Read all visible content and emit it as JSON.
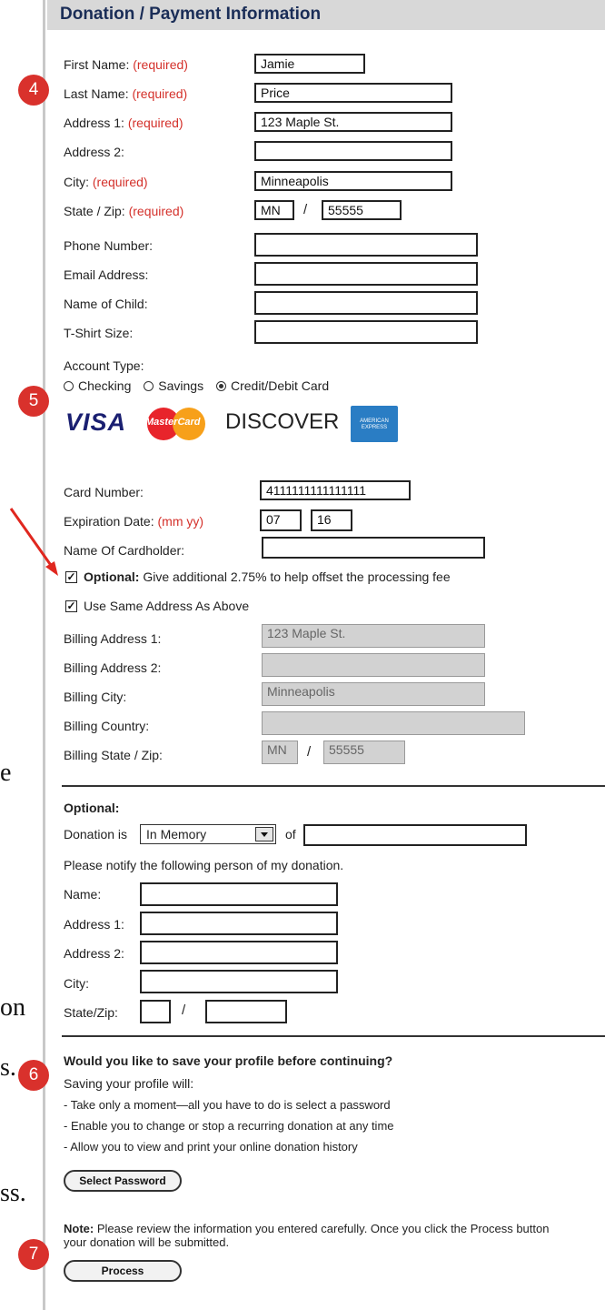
{
  "header": {
    "title": "Donation / Payment Information"
  },
  "badges": {
    "b4": "4",
    "b5": "5",
    "b6": "6",
    "b7": "7"
  },
  "edge_text": {
    "e1": "e",
    "e2": "on",
    "e3": "s.",
    "e4": "ss."
  },
  "personal": {
    "first_name": {
      "label": "First Name:",
      "req": "(required)",
      "value": "Jamie"
    },
    "last_name": {
      "label": "Last Name:",
      "req": "(required)",
      "value": "Price"
    },
    "address1": {
      "label": "Address 1:",
      "req": "(required)",
      "value": "123 Maple St."
    },
    "address2": {
      "label": "Address 2:",
      "value": ""
    },
    "city": {
      "label": "City:",
      "req": "(required)",
      "value": "Minneapolis"
    },
    "state_zip": {
      "label": "State / Zip:",
      "req": "(required)",
      "state": "MN",
      "zip": "55555",
      "sep": "/"
    },
    "phone": {
      "label": "Phone Number:",
      "value": ""
    },
    "email": {
      "label": "Email Address:",
      "value": ""
    },
    "child": {
      "label": "Name of Child:",
      "value": ""
    },
    "tshirt": {
      "label": "T-Shirt Size:",
      "value": ""
    }
  },
  "account": {
    "label": "Account Type:",
    "options": [
      "Checking",
      "Savings",
      "Credit/Debit Card"
    ],
    "selected": "Credit/Debit Card"
  },
  "cards": {
    "visa": "VISA",
    "mastercard": "MasterCard",
    "discover": "DISCOVER",
    "amex": "AMERICAN EXPRESS"
  },
  "card": {
    "number": {
      "label": "Card Number:",
      "value": "4111111111111111"
    },
    "expiration": {
      "label": "Expiration Date:",
      "hint": "(mm yy)",
      "mm": "07",
      "yy": "16"
    },
    "cardholder": {
      "label": "Name Of Cardholder:",
      "value": ""
    },
    "optional_fee": {
      "bold": "Optional:",
      "text": "Give additional 2.75% to help offset the processing fee",
      "checked": true
    },
    "same_address": {
      "text": "Use Same Address As Above",
      "checked": true
    }
  },
  "billing": {
    "address1": {
      "label": "Billing Address 1:",
      "value": "123 Maple St."
    },
    "address2": {
      "label": "Billing Address 2:",
      "value": ""
    },
    "city": {
      "label": "Billing City:",
      "value": "Minneapolis"
    },
    "country": {
      "label": "Billing Country:",
      "value": ""
    },
    "state_zip": {
      "label": "Billing State / Zip:",
      "state": "MN",
      "zip": "55555",
      "sep": "/"
    }
  },
  "optional": {
    "heading": "Optional:",
    "donation_is": "Donation is",
    "donation_type": "In Memory",
    "of": "of",
    "of_value": "",
    "notify": "Please notify the following person of my donation.",
    "name": "Name:",
    "address1": "Address 1:",
    "address2": "Address 2:",
    "city": "City:",
    "state_zip": "State/Zip:",
    "sep": "/"
  },
  "profile": {
    "question": "Would you like to save your profile before continuing?",
    "intro": "Saving your profile will:",
    "bullets": [
      "- Take only a moment—all you have to do is select a password",
      "- Enable you to change or stop a recurring donation at any time",
      "- Allow you to view and print your online donation history"
    ],
    "select_password": "Select Password"
  },
  "note": {
    "bold": "Note:",
    "text": "Please review the information you entered carefully. Once you click the Process button your donation will be submitted.",
    "process": "Process"
  },
  "colors": {
    "required": "#d4302a",
    "header_bg": "#d8d8d8",
    "header_text": "#1a2d57",
    "badge": "#d9312c"
  }
}
